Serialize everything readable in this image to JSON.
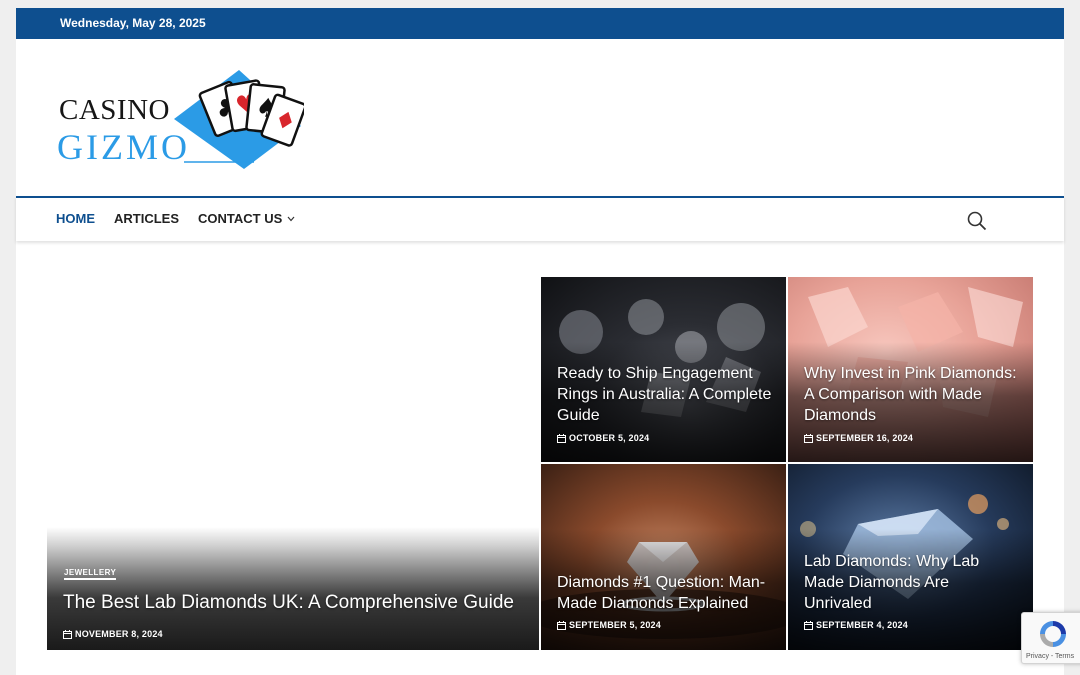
{
  "topbar": {
    "date": "Wednesday, May 28, 2025",
    "bg_color": "#0e4f8f"
  },
  "logo": {
    "line1": "CASINO",
    "line2": "GIZMO",
    "icon": "playing-cards-logo-icon"
  },
  "nav": {
    "items": [
      {
        "label": "HOME",
        "active": true
      },
      {
        "label": "ARTICLES",
        "active": false
      },
      {
        "label": "CONTACT US",
        "active": false,
        "has_dropdown": true
      }
    ],
    "search_icon": "search-icon",
    "accent_color": "#0e4f8f"
  },
  "featured": {
    "big": {
      "category": "JEWELLERY",
      "title": "The Best Lab Diamonds UK: A Comprehensive Guide",
      "date": "NOVEMBER 8, 2024"
    },
    "tiles": [
      {
        "title": "Ready to Ship Engagement Rings in Australia: A Complete Guide",
        "date": "OCTOBER 5, 2024"
      },
      {
        "title": "Why Invest in Pink Diamonds: A Comparison with Made Diamonds",
        "date": "SEPTEMBER 16, 2024"
      },
      {
        "title": "Diamonds #1 Question: Man-Made Diamonds Explained",
        "date": "SEPTEMBER 5, 2024"
      },
      {
        "title": "Lab Diamonds: Why Lab Made Diamonds Are Unrivaled",
        "date": "SEPTEMBER 4, 2024"
      }
    ],
    "date_icon": "calendar-icon"
  },
  "recaptcha": {
    "links": "Privacy - Terms",
    "icon": "recaptcha-icon"
  }
}
